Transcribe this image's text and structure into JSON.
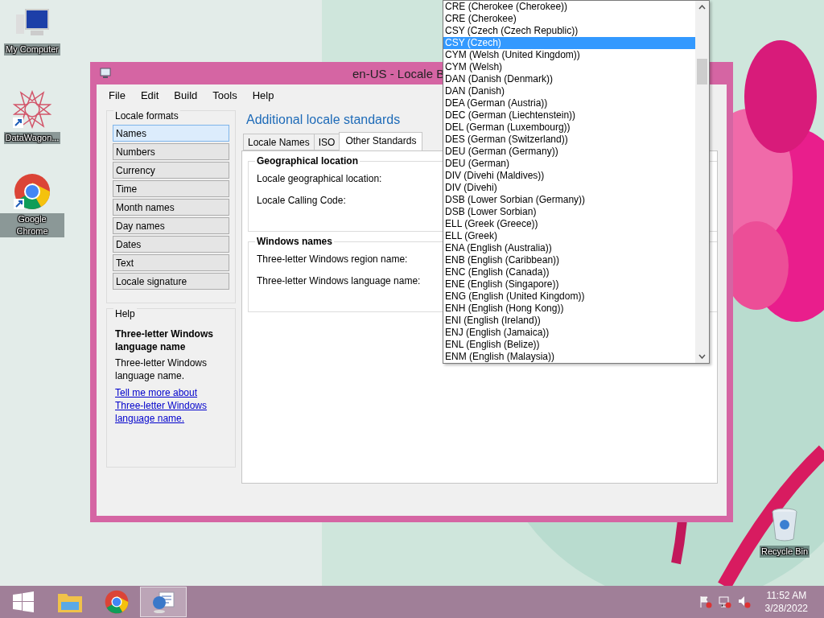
{
  "desktop_icons": [
    {
      "label": "My Computer",
      "kind": "computer"
    },
    {
      "label": "DataWagon...",
      "kind": "star"
    },
    {
      "label": "Google Chrome",
      "kind": "chrome"
    },
    {
      "label": "Recycle Bin",
      "kind": "bin"
    }
  ],
  "window": {
    "title": "en-US - Locale B",
    "menu": [
      "File",
      "Edit",
      "Build",
      "Tools",
      "Help"
    ],
    "locale_formats": {
      "title": "Locale formats",
      "items": [
        {
          "label": "Names",
          "selected": true
        },
        {
          "label": "Numbers",
          "selected": false
        },
        {
          "label": "Currency",
          "selected": false
        },
        {
          "label": "Time",
          "selected": false
        },
        {
          "label": "Month names",
          "selected": false
        },
        {
          "label": "Day names",
          "selected": false
        },
        {
          "label": "Dates",
          "selected": false
        },
        {
          "label": "Text",
          "selected": false
        },
        {
          "label": "Locale signature",
          "selected": false
        }
      ]
    },
    "help": {
      "title": "Help",
      "heading": "Three-letter Windows language name",
      "text": "Three-letter Windows language name.",
      "link": "Tell me more about Three-letter Windows language name."
    },
    "heading": "Additional locale standards",
    "tabs": [
      {
        "label": "Locale Names",
        "selected": false
      },
      {
        "label": "ISO",
        "selected": false
      },
      {
        "label": "Other Standards",
        "selected": true
      }
    ],
    "groups": [
      {
        "title": "Geographical location",
        "fields": [
          "Locale geographical location:",
          "Locale Calling Code:"
        ]
      },
      {
        "title": "Windows names",
        "fields": [
          "Three-letter Windows region name:",
          "Three-letter Windows language name:"
        ]
      }
    ]
  },
  "dropdown": {
    "items": [
      {
        "label": "CRE (Cherokee (Cherokee))",
        "selected": false
      },
      {
        "label": "CRE (Cherokee)",
        "selected": false
      },
      {
        "label": "CSY (Czech (Czech Republic))",
        "selected": false
      },
      {
        "label": "CSY (Czech)",
        "selected": true
      },
      {
        "label": "CYM (Welsh (United Kingdom))",
        "selected": false
      },
      {
        "label": "CYM (Welsh)",
        "selected": false
      },
      {
        "label": "DAN (Danish (Denmark))",
        "selected": false
      },
      {
        "label": "DAN (Danish)",
        "selected": false
      },
      {
        "label": "DEA (German (Austria))",
        "selected": false
      },
      {
        "label": "DEC (German (Liechtenstein))",
        "selected": false
      },
      {
        "label": "DEL (German (Luxembourg))",
        "selected": false
      },
      {
        "label": "DES (German (Switzerland))",
        "selected": false
      },
      {
        "label": "DEU (German (Germany))",
        "selected": false
      },
      {
        "label": "DEU (German)",
        "selected": false
      },
      {
        "label": "DIV (Divehi (Maldives))",
        "selected": false
      },
      {
        "label": "DIV (Divehi)",
        "selected": false
      },
      {
        "label": "DSB (Lower Sorbian (Germany))",
        "selected": false
      },
      {
        "label": "DSB (Lower Sorbian)",
        "selected": false
      },
      {
        "label": "ELL (Greek (Greece))",
        "selected": false
      },
      {
        "label": "ELL (Greek)",
        "selected": false
      },
      {
        "label": "ENA (English (Australia))",
        "selected": false
      },
      {
        "label": "ENB (English (Caribbean))",
        "selected": false
      },
      {
        "label": "ENC (English (Canada))",
        "selected": false
      },
      {
        "label": "ENE (English (Singapore))",
        "selected": false
      },
      {
        "label": "ENG (English (United Kingdom))",
        "selected": false
      },
      {
        "label": "ENH (English (Hong Kong))",
        "selected": false
      },
      {
        "label": "ENI (English (Ireland))",
        "selected": false
      },
      {
        "label": "ENJ (English (Jamaica))",
        "selected": false
      },
      {
        "label": "ENL (English (Belize))",
        "selected": false
      },
      {
        "label": "ENM (English (Malaysia))",
        "selected": false
      }
    ]
  },
  "taskbar": {
    "apps": [
      {
        "kind": "start",
        "selected": false
      },
      {
        "kind": "explorer",
        "selected": false
      },
      {
        "kind": "chrome",
        "selected": false
      },
      {
        "kind": "locale",
        "selected": true
      }
    ],
    "time": "11:52 AM",
    "date": "3/28/2022"
  }
}
